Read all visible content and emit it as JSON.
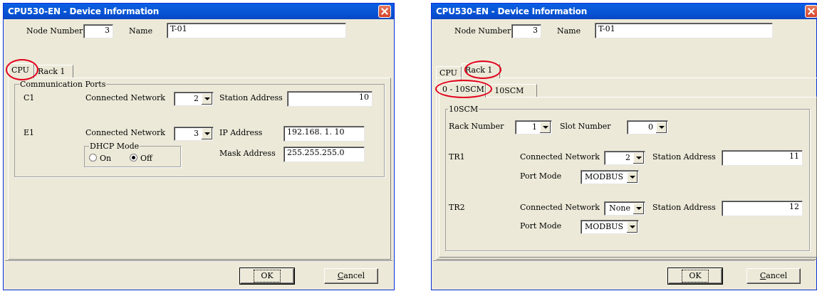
{
  "left": {
    "title": "CPU530-EN - Device Information",
    "node_number_label": "Node Number",
    "node_number": "3",
    "name_label": "Name",
    "name": "T-01",
    "tabs": [
      "CPU",
      "Rack 1"
    ],
    "comm_group": "Communication Ports",
    "c1": {
      "port": "C1",
      "network_label": "Connected Network",
      "network": "2",
      "station_label": "Station Address",
      "station": "10"
    },
    "e1": {
      "port": "E1",
      "network_label": "Connected Network",
      "network": "3",
      "ip_label": "IP Address",
      "ip": "192.168.  1. 10",
      "mask_label": "Mask Address",
      "mask": "255.255.255.0",
      "dhcp_label": "DHCP Mode",
      "dhcp_on": "On",
      "dhcp_off": "Off",
      "dhcp_selected": "Off"
    },
    "ok": "OK",
    "cancel_prefix": "C",
    "cancel_rest": "ancel"
  },
  "right": {
    "title": "CPU530-EN - Device Information",
    "node_number_label": "Node Number",
    "node_number": "3",
    "name_label": "Name",
    "name": "T-01",
    "tabs": [
      "CPU",
      "Rack 1"
    ],
    "subtabs": [
      "0 - 10SCM",
      "- 10SCM"
    ],
    "group": "10SCM",
    "rack_label": "Rack Number",
    "rack": "1",
    "slot_label": "Slot Number",
    "slot": "0",
    "tr1": {
      "port": "TR1",
      "network_label": "Connected Network",
      "network": "2",
      "station_label": "Station Address",
      "station": "11",
      "mode_label": "Port Mode",
      "mode": "MODBUS"
    },
    "tr2": {
      "port": "TR2",
      "network_label": "Connected Network",
      "network": "None",
      "station_label": "Station Address",
      "station": "12",
      "mode_label": "Port Mode",
      "mode": "MODBUS"
    },
    "ok": "OK",
    "cancel_prefix": "C",
    "cancel_rest": "ancel"
  },
  "colors": {
    "titlebar": "#0a5fe6",
    "window_bg": "#ece9d8",
    "highlight_circle": "#e3001b"
  }
}
